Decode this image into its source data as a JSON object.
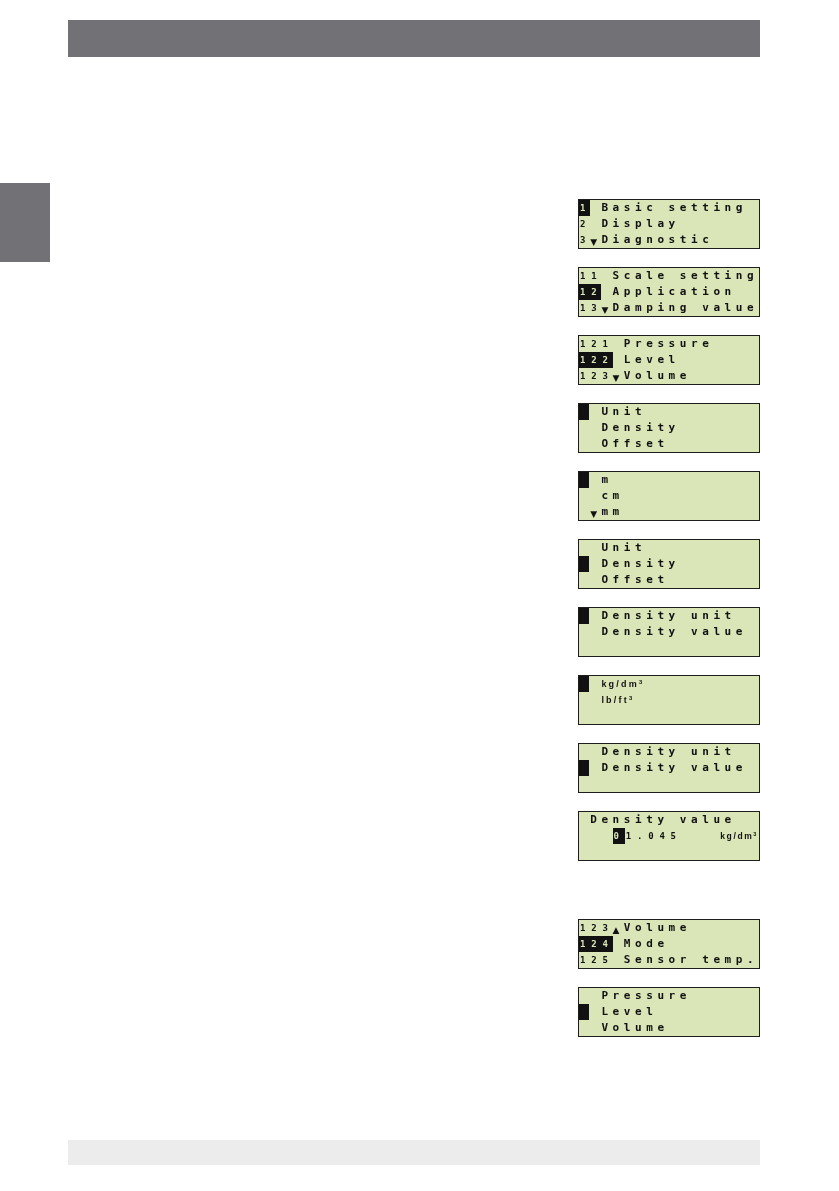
{
  "sections": [
    {
      "displays": [
        {
          "kind": "menu",
          "lines": [
            {
              "number": "1",
              "text": "Basic setting",
              "selected": true
            },
            {
              "number": "2",
              "text": "Display",
              "selected": false
            },
            {
              "number": "3",
              "scroll_mark": "▼",
              "text": "Diagnostic",
              "selected": false
            }
          ]
        },
        {
          "kind": "menu",
          "lines": [
            {
              "number": "11",
              "text": "Scale setting",
              "selected": false
            },
            {
              "number": "12",
              "text": "Application",
              "selected": true
            },
            {
              "number": "13",
              "scroll_mark": "▼",
              "text": "Damping value",
              "selected": false
            }
          ]
        },
        {
          "kind": "menu",
          "lines": [
            {
              "number": "121",
              "text": "Pressure",
              "selected": false
            },
            {
              "number": "122",
              "text": "Level",
              "selected": true
            },
            {
              "number": "123",
              "scroll_mark": "▼",
              "text": "Volume",
              "selected": false
            }
          ]
        },
        {
          "kind": "menu",
          "lines": [
            {
              "text": "Unit",
              "selected": true
            },
            {
              "text": "Density",
              "selected": false
            },
            {
              "text": "Offset",
              "selected": false
            }
          ]
        },
        {
          "kind": "menu",
          "lines": [
            {
              "text": "m",
              "selected": true
            },
            {
              "text": "cm",
              "selected": false
            },
            {
              "scroll_mark": "▼",
              "text": "mm",
              "selected": false
            }
          ]
        },
        {
          "kind": "menu",
          "lines": [
            {
              "text": "Unit",
              "selected": false
            },
            {
              "text": "Density",
              "selected": true
            },
            {
              "text": "Offset",
              "selected": false
            }
          ]
        },
        {
          "kind": "menu",
          "lines": [
            {
              "text": "Density unit",
              "selected": true
            },
            {
              "text": "Density value",
              "selected": false
            }
          ]
        },
        {
          "kind": "unit_menu",
          "lines": [
            {
              "text": "kg/dm$^{3}$",
              "selected": true
            },
            {
              "text": "lb/ft$^{3}$",
              "selected": false
            }
          ]
        },
        {
          "kind": "menu",
          "lines": [
            {
              "text": "Density unit",
              "selected": false
            },
            {
              "text": "Density value",
              "selected": true
            }
          ]
        },
        {
          "kind": "value_editor",
          "title": "Density value",
          "value": [
            {
              "text": "0",
              "selected": true
            },
            {
              "text": "1.045",
              "selected": false
            }
          ],
          "unit": "kg/dm$^{3}$"
        }
      ]
    },
    {
      "displays": [
        {
          "kind": "menu",
          "lines": [
            {
              "number": "123",
              "scroll_mark": "▲",
              "text": "Volume",
              "selected": false
            },
            {
              "number": "124",
              "text": "Mode",
              "selected": true
            },
            {
              "number": "125",
              "text": "Sensor temp.",
              "selected": false
            }
          ]
        },
        {
          "kind": "menu",
          "lines": [
            {
              "text": "Pressure",
              "selected": false
            },
            {
              "text": "Level",
              "selected": true
            },
            {
              "text": "Volume",
              "selected": false
            }
          ]
        }
      ]
    }
  ]
}
